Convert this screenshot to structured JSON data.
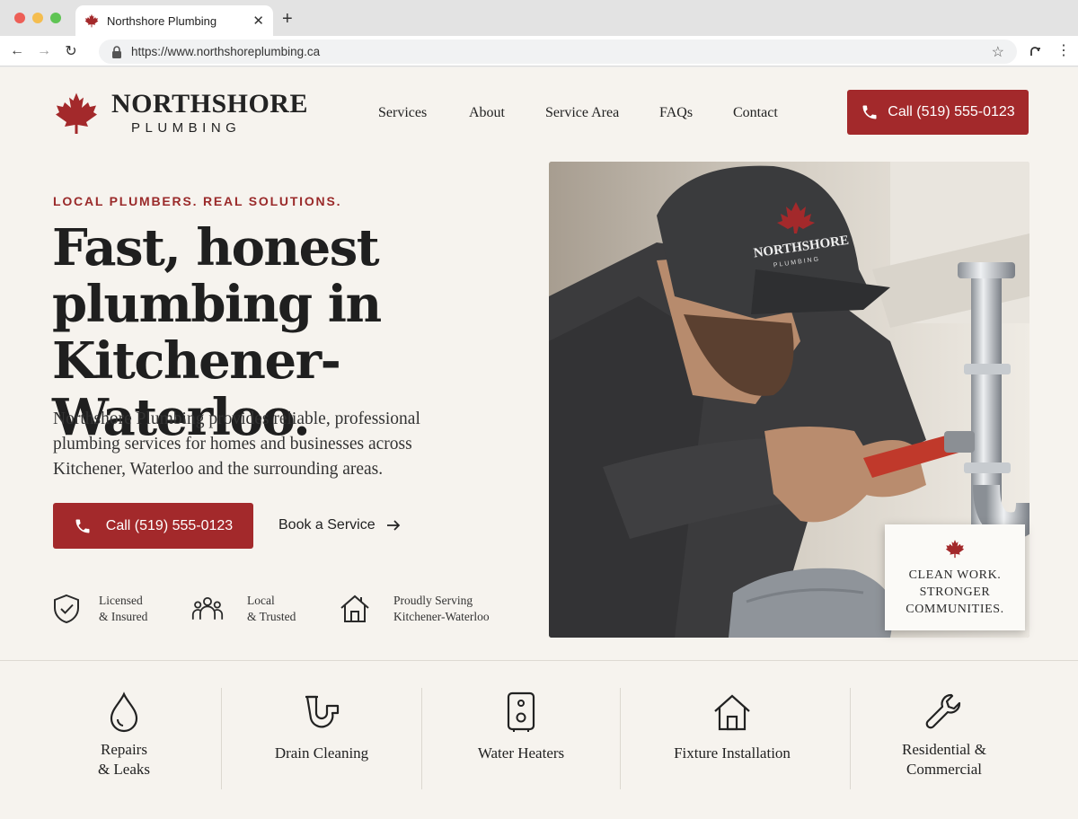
{
  "browser": {
    "tab_title": "Northshore Plumbing",
    "tab_close": "✕",
    "new_tab": "+",
    "url": "https://www.northshoreplumbing.ca",
    "back": "←",
    "forward": "→",
    "reload": "↻",
    "star": "☆",
    "menu": "⋮"
  },
  "header": {
    "brand_name": "NORTHSHORE",
    "brand_sub": "PLUMBING",
    "nav": [
      {
        "label": "Services"
      },
      {
        "label": "About"
      },
      {
        "label": "Service Area"
      },
      {
        "label": "FAQs"
      },
      {
        "label": "Contact"
      }
    ],
    "call_label": "Call (519) 555-0123"
  },
  "hero": {
    "eyebrow": "LOCAL PLUMBERS. REAL SOLUTIONS.",
    "title": "Fast, honest plumbing in Kitchener-Waterloo.",
    "description": "Northshore Plumbing provides reliable, professional plumbing services for homes and businesses across Kitchener, Waterloo and the surrounding areas.",
    "call_label": "Call (519) 555-0123",
    "book_label": "Book a Service"
  },
  "badges": [
    {
      "line1": "Licensed",
      "line2": "& Insured",
      "icon": "shield-check-icon"
    },
    {
      "line1": "Local",
      "line2": "& Trusted",
      "icon": "people-group-icon"
    },
    {
      "line1": "Proudly Serving",
      "line2": "Kitchener-Waterloo",
      "icon": "house-icon"
    }
  ],
  "photo": {
    "cap_brand": "NORTHSHORE",
    "cap_sub": "PLUMBING",
    "tagline": [
      "CLEAN WORK.",
      "STRONGER",
      "COMMUNITIES."
    ]
  },
  "services": [
    {
      "line1": "Repairs",
      "line2": "& Leaks",
      "icon": "water-drop-icon"
    },
    {
      "line1": "Drain Cleaning",
      "line2": "",
      "icon": "drain-pipe-icon"
    },
    {
      "line1": "Water Heaters",
      "line2": "",
      "icon": "water-heater-icon"
    },
    {
      "line1": "Fixture Installation",
      "line2": "",
      "icon": "house-icon"
    },
    {
      "line1": "Residential &",
      "line2": "Commercial",
      "icon": "wrench-icon"
    }
  ],
  "colors": {
    "accent": "#a3292b",
    "page_bg": "#f6f3ee",
    "text": "#222222"
  }
}
